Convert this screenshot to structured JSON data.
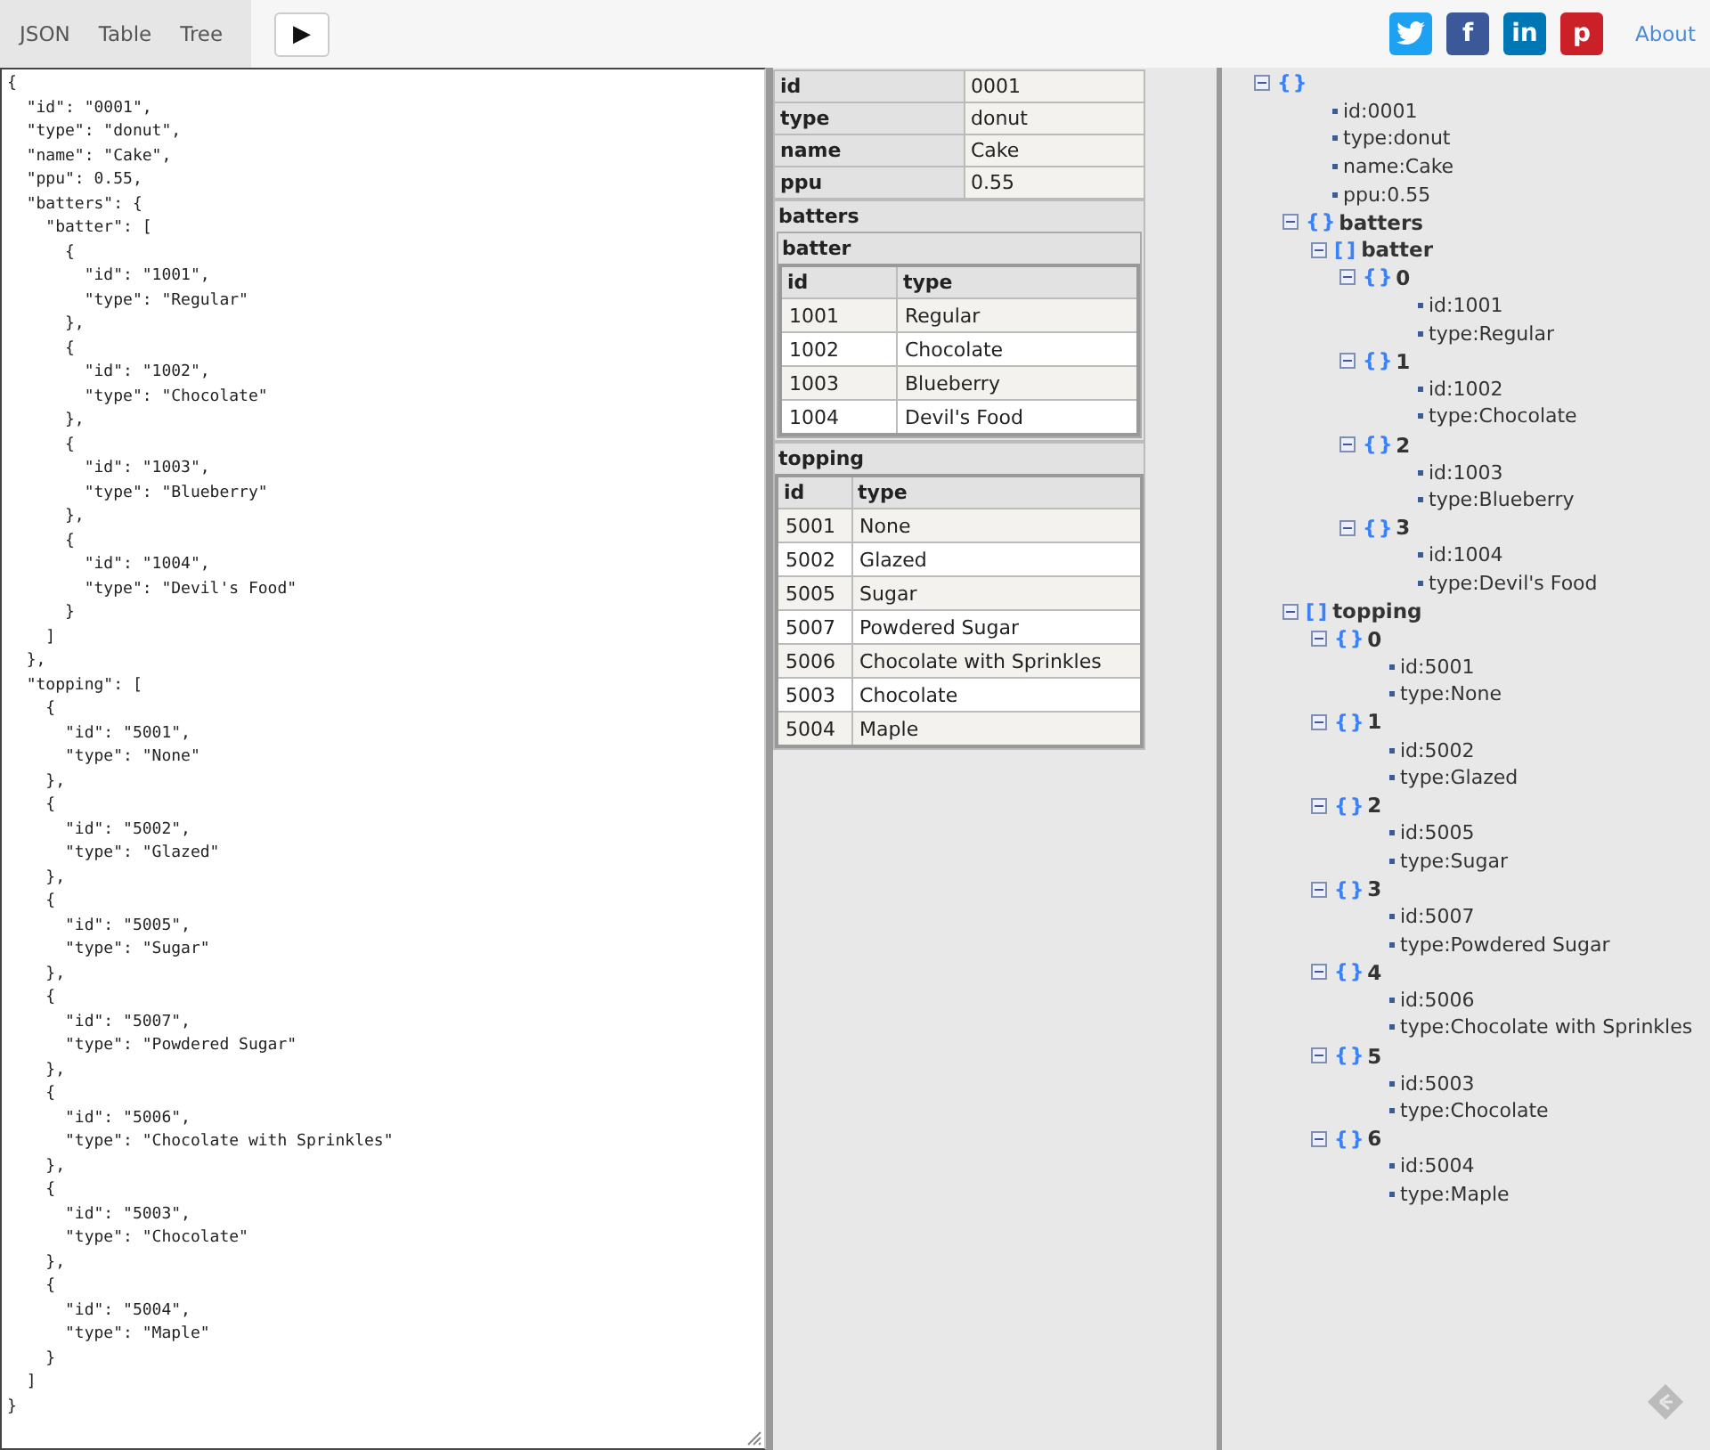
{
  "tabs": [
    {
      "label": "JSON",
      "selected": false
    },
    {
      "label": "Table",
      "selected": false
    },
    {
      "label": "Tree",
      "selected": false
    }
  ],
  "run_button": {
    "glyph": "▶"
  },
  "social": [
    {
      "kind": "twitter"
    },
    {
      "kind": "facebook",
      "glyph": "f"
    },
    {
      "kind": "linkedin",
      "glyph": "in"
    },
    {
      "kind": "pinterest",
      "glyph": "p"
    }
  ],
  "about_link": "About",
  "editor": {
    "value": "{\n  \"id\": \"0001\",\n  \"type\": \"donut\",\n  \"name\": \"Cake\",\n  \"ppu\": 0.55,\n  \"batters\": {\n    \"batter\": [\n      {\n        \"id\": \"1001\",\n        \"type\": \"Regular\"\n      },\n      {\n        \"id\": \"1002\",\n        \"type\": \"Chocolate\"\n      },\n      {\n        \"id\": \"1003\",\n        \"type\": \"Blueberry\"\n      },\n      {\n        \"id\": \"1004\",\n        \"type\": \"Devil's Food\"\n      }\n    ]\n  },\n  \"topping\": [\n    {\n      \"id\": \"5001\",\n      \"type\": \"None\"\n    },\n    {\n      \"id\": \"5002\",\n      \"type\": \"Glazed\"\n    },\n    {\n      \"id\": \"5005\",\n      \"type\": \"Sugar\"\n    },\n    {\n      \"id\": \"5007\",\n      \"type\": \"Powdered Sugar\"\n    },\n    {\n      \"id\": \"5006\",\n      \"type\": \"Chocolate with Sprinkles\"\n    },\n    {\n      \"id\": \"5003\",\n      \"type\": \"Chocolate\"\n    },\n    {\n      \"id\": \"5004\",\n      \"type\": \"Maple\"\n    }\n  ]\n}"
  },
  "table": {
    "fields": [
      {
        "key": "id",
        "value": "0001"
      },
      {
        "key": "type",
        "value": "donut"
      },
      {
        "key": "name",
        "value": "Cake"
      },
      {
        "key": "ppu",
        "value": "0.55"
      }
    ],
    "groups": [
      {
        "kind": "object",
        "title": "batters",
        "tables": [
          {
            "title": "batter",
            "columns": [
              "id",
              "type"
            ],
            "rows": [
              [
                "1001",
                "Regular"
              ],
              [
                "1002",
                "Chocolate"
              ],
              [
                "1003",
                "Blueberry"
              ],
              [
                "1004",
                "Devil's Food"
              ]
            ]
          }
        ]
      },
      {
        "kind": "array",
        "title": "topping",
        "columns": [
          "id",
          "type"
        ],
        "rows": [
          [
            "5001",
            "None"
          ],
          [
            "5002",
            "Glazed"
          ],
          [
            "5005",
            "Sugar"
          ],
          [
            "5007",
            "Powdered Sugar"
          ],
          [
            "5006",
            "Chocolate with Sprinkles"
          ],
          [
            "5003",
            "Chocolate"
          ],
          [
            "5004",
            "Maple"
          ]
        ]
      }
    ]
  },
  "tree": {
    "kind": "object",
    "bracket": "{}",
    "expanded": true,
    "children": [
      {
        "kind": "value",
        "text": "id:0001"
      },
      {
        "kind": "value",
        "text": "type:donut"
      },
      {
        "kind": "value",
        "text": "name:Cake"
      },
      {
        "kind": "value",
        "text": "ppu:0.55"
      },
      {
        "kind": "object",
        "bracket": "{}",
        "label": "batters",
        "expanded": true,
        "children": [
          {
            "kind": "array",
            "bracket": "[]",
            "label": "batter",
            "expanded": true,
            "children": [
              {
                "kind": "object",
                "bracket": "{}",
                "label": "0",
                "expanded": true,
                "children": [
                  {
                    "kind": "value",
                    "text": "id:1001"
                  },
                  {
                    "kind": "value",
                    "text": "type:Regular"
                  }
                ]
              },
              {
                "kind": "object",
                "bracket": "{}",
                "label": "1",
                "expanded": true,
                "children": [
                  {
                    "kind": "value",
                    "text": "id:1002"
                  },
                  {
                    "kind": "value",
                    "text": "type:Chocolate"
                  }
                ]
              },
              {
                "kind": "object",
                "bracket": "{}",
                "label": "2",
                "expanded": true,
                "children": [
                  {
                    "kind": "value",
                    "text": "id:1003"
                  },
                  {
                    "kind": "value",
                    "text": "type:Blueberry"
                  }
                ]
              },
              {
                "kind": "object",
                "bracket": "{}",
                "label": "3",
                "expanded": true,
                "children": [
                  {
                    "kind": "value",
                    "text": "id:1004"
                  },
                  {
                    "kind": "value",
                    "text": "type:Devil's Food"
                  }
                ]
              }
            ]
          }
        ]
      },
      {
        "kind": "array",
        "bracket": "[]",
        "label": "topping",
        "expanded": true,
        "children": [
          {
            "kind": "object",
            "bracket": "{}",
            "label": "0",
            "expanded": true,
            "children": [
              {
                "kind": "value",
                "text": "id:5001"
              },
              {
                "kind": "value",
                "text": "type:None"
              }
            ]
          },
          {
            "kind": "object",
            "bracket": "{}",
            "label": "1",
            "expanded": true,
            "children": [
              {
                "kind": "value",
                "text": "id:5002"
              },
              {
                "kind": "value",
                "text": "type:Glazed"
              }
            ]
          },
          {
            "kind": "object",
            "bracket": "{}",
            "label": "2",
            "expanded": true,
            "children": [
              {
                "kind": "value",
                "text": "id:5005"
              },
              {
                "kind": "value",
                "text": "type:Sugar"
              }
            ]
          },
          {
            "kind": "object",
            "bracket": "{}",
            "label": "3",
            "expanded": true,
            "children": [
              {
                "kind": "value",
                "text": "id:5007"
              },
              {
                "kind": "value",
                "text": "type:Powdered Sugar"
              }
            ]
          },
          {
            "kind": "object",
            "bracket": "{}",
            "label": "4",
            "expanded": true,
            "children": [
              {
                "kind": "value",
                "text": "id:5006"
              },
              {
                "kind": "value",
                "text": "type:Chocolate with Sprinkles"
              }
            ]
          },
          {
            "kind": "object",
            "bracket": "{}",
            "label": "5",
            "expanded": true,
            "children": [
              {
                "kind": "value",
                "text": "id:5003"
              },
              {
                "kind": "value",
                "text": "type:Chocolate"
              }
            ]
          },
          {
            "kind": "object",
            "bracket": "{}",
            "label": "6",
            "expanded": true,
            "children": [
              {
                "kind": "value",
                "text": "id:5004"
              },
              {
                "kind": "value",
                "text": "type:Maple"
              }
            ]
          }
        ]
      }
    ]
  }
}
